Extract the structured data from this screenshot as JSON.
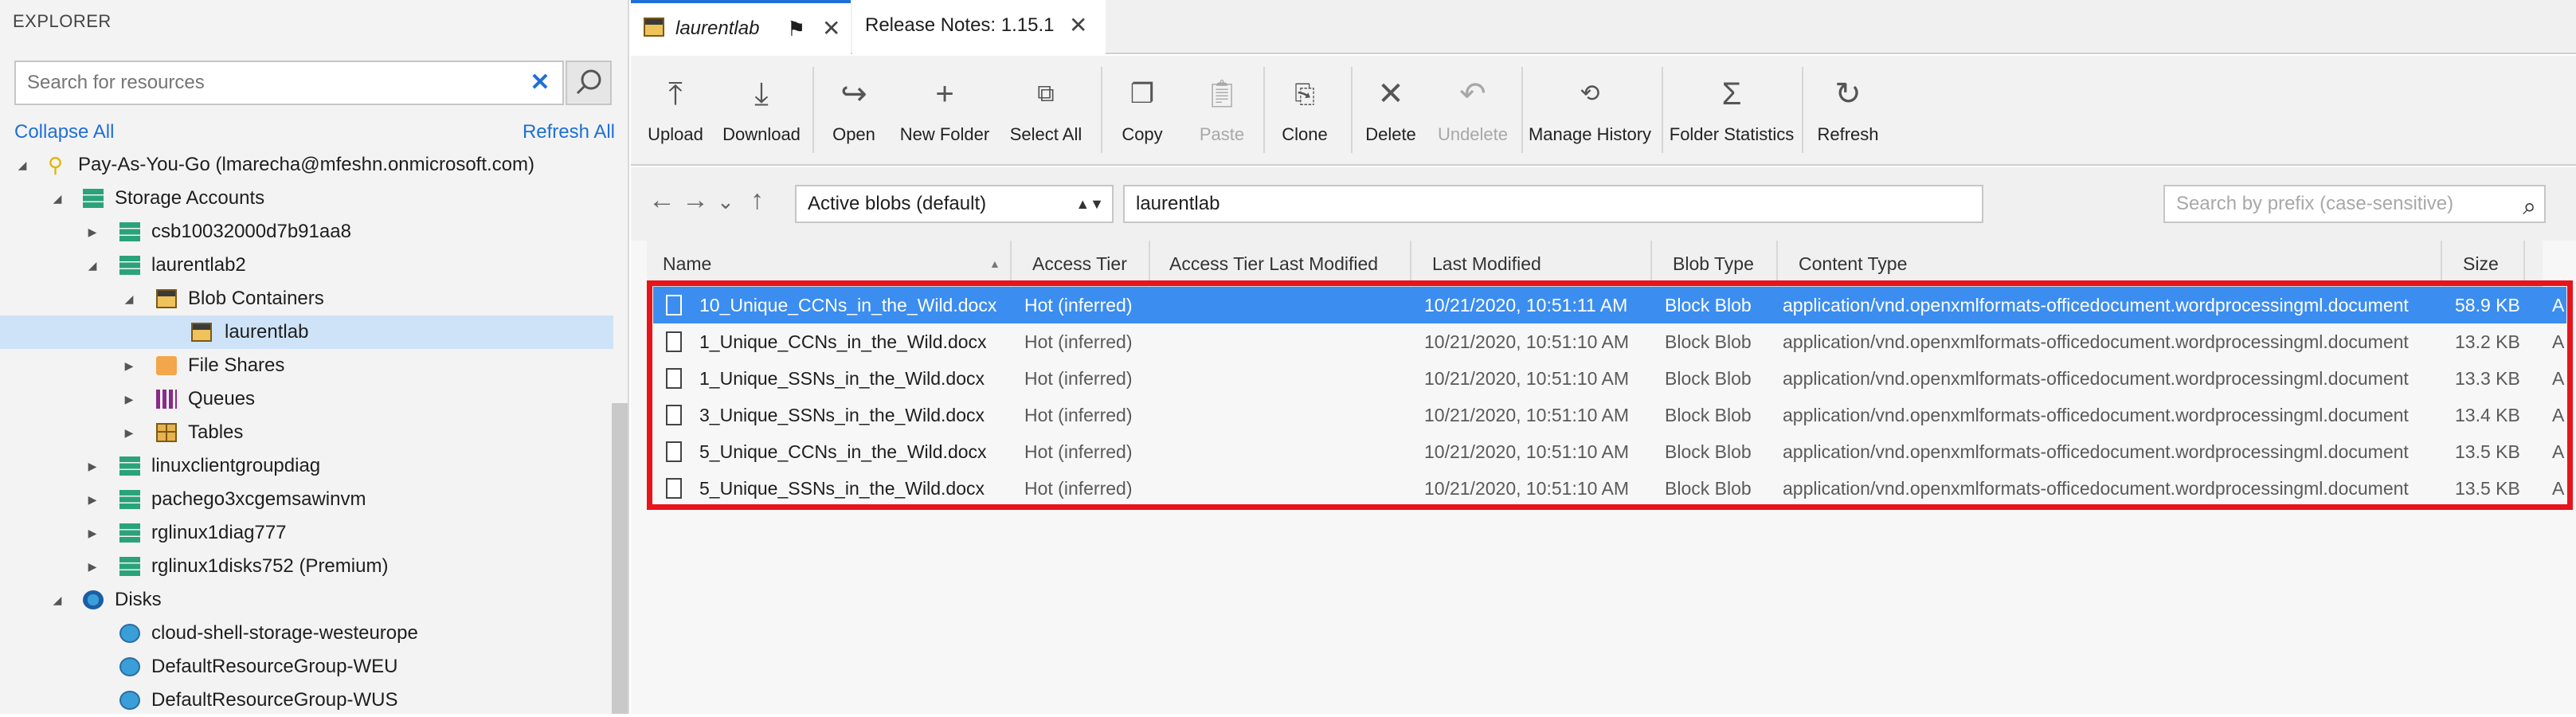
{
  "explorer": {
    "title": "EXPLORER",
    "search_placeholder": "Search for resources",
    "collapse_all": "Collapse All",
    "refresh_all": "Refresh All",
    "tree": [
      {
        "label": "Pay-As-You-Go (lmarecha@mfeshn.onmicrosoft.com)",
        "icon": "key-icon",
        "arrow": "◢"
      },
      {
        "label": "Storage Accounts",
        "icon": "storage-icon",
        "arrow": "◢"
      },
      {
        "label": "csb10032000d7b91aa8",
        "icon": "storage-account-icon",
        "arrow": "▶"
      },
      {
        "label": "laurentlab2",
        "icon": "storage-account-icon",
        "arrow": "◢"
      },
      {
        "label": "Blob Containers",
        "icon": "blob-containers-icon",
        "arrow": "◢"
      },
      {
        "label": "laurentlab",
        "icon": "container-icon",
        "arrow": ""
      },
      {
        "label": "File Shares",
        "icon": "file-shares-icon",
        "arrow": "▶"
      },
      {
        "label": "Queues",
        "icon": "queues-icon",
        "arrow": "▶"
      },
      {
        "label": "Tables",
        "icon": "tables-icon",
        "arrow": "▶"
      },
      {
        "label": "linuxclientgroupdiag",
        "icon": "storage-account-icon",
        "arrow": "▶"
      },
      {
        "label": "pachego3xcgemsawinvm",
        "icon": "storage-account-icon",
        "arrow": "▶"
      },
      {
        "label": "rglinux1diag777",
        "icon": "storage-account-icon",
        "arrow": "▶"
      },
      {
        "label": "rglinux1disks752 (Premium)",
        "icon": "storage-account-icon",
        "arrow": "▶"
      },
      {
        "label": "Disks",
        "icon": "disks-icon",
        "arrow": "◢"
      },
      {
        "label": "cloud-shell-storage-westeurope",
        "icon": "disk-icon",
        "arrow": ""
      },
      {
        "label": "DefaultResourceGroup-WEU",
        "icon": "disk-icon",
        "arrow": ""
      },
      {
        "label": "DefaultResourceGroup-WUS",
        "icon": "disk-icon",
        "arrow": ""
      }
    ]
  },
  "tabs": [
    {
      "label": "laurentlab",
      "active": true
    },
    {
      "label": "Release Notes: 1.15.1",
      "active": false
    }
  ],
  "toolbar": {
    "upload": "Upload",
    "download": "Download",
    "open": "Open",
    "new_folder": "New Folder",
    "select_all": "Select All",
    "copy": "Copy",
    "paste": "Paste",
    "clone": "Clone",
    "delete": "Delete",
    "undelete": "Undelete",
    "manage_history": "Manage History",
    "folder_statistics": "Folder Statistics",
    "refresh": "Refresh"
  },
  "address": {
    "view_mode": "Active blobs (default)",
    "path": "laurentlab",
    "prefix_placeholder": "Search by prefix (case-sensitive)"
  },
  "grid": {
    "columns": [
      "Name",
      "Access Tier",
      "Access Tier Last Modified",
      "Last Modified",
      "Blob Type",
      "Content Type",
      "Size"
    ],
    "rows": [
      {
        "name": "10_Unique_CCNs_in_the_Wild.docx",
        "tier": "Hot (inferred)",
        "tier_modified": "",
        "modified": "10/21/2020, 10:51:11 AM",
        "type": "Block Blob",
        "content": "application/vnd.openxmlformats-officedocument.wordprocessingml.document",
        "size": "58.9 KB",
        "extra": "A"
      },
      {
        "name": "1_Unique_CCNs_in_the_Wild.docx",
        "tier": "Hot (inferred)",
        "tier_modified": "",
        "modified": "10/21/2020, 10:51:10 AM",
        "type": "Block Blob",
        "content": "application/vnd.openxmlformats-officedocument.wordprocessingml.document",
        "size": "13.2 KB",
        "extra": "A"
      },
      {
        "name": "1_Unique_SSNs_in_the_Wild.docx",
        "tier": "Hot (inferred)",
        "tier_modified": "",
        "modified": "10/21/2020, 10:51:10 AM",
        "type": "Block Blob",
        "content": "application/vnd.openxmlformats-officedocument.wordprocessingml.document",
        "size": "13.3 KB",
        "extra": "A"
      },
      {
        "name": "3_Unique_SSNs_in_the_Wild.docx",
        "tier": "Hot (inferred)",
        "tier_modified": "",
        "modified": "10/21/2020, 10:51:10 AM",
        "type": "Block Blob",
        "content": "application/vnd.openxmlformats-officedocument.wordprocessingml.document",
        "size": "13.4 KB",
        "extra": "A"
      },
      {
        "name": "5_Unique_CCNs_in_the_Wild.docx",
        "tier": "Hot (inferred)",
        "tier_modified": "",
        "modified": "10/21/2020, 10:51:10 AM",
        "type": "Block Blob",
        "content": "application/vnd.openxmlformats-officedocument.wordprocessingml.document",
        "size": "13.5 KB",
        "extra": "A"
      },
      {
        "name": "5_Unique_SSNs_in_the_Wild.docx",
        "tier": "Hot (inferred)",
        "tier_modified": "",
        "modified": "10/21/2020, 10:51:10 AM",
        "type": "Block Blob",
        "content": "application/vnd.openxmlformats-officedocument.wordprocessingml.document",
        "size": "13.5 KB",
        "extra": "A"
      }
    ]
  },
  "colors": {
    "accent": "#1f6fd6",
    "selection": "#3b8df0",
    "highlight_border": "#e8141c"
  }
}
